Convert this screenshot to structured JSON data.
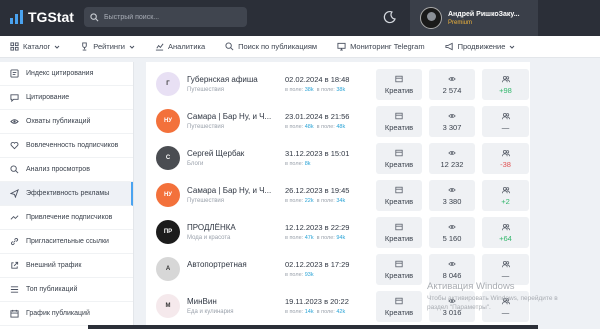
{
  "header": {
    "logo_text": "TGStat",
    "search_placeholder": "Быстрый поиск...",
    "user_name": "Андрей РишкоЗаку...",
    "user_plan": "Premium"
  },
  "nav": {
    "items": [
      {
        "label": "Каталог",
        "icon": "grid-icon",
        "dropdown": true
      },
      {
        "label": "Рейтинги",
        "icon": "trophy-icon",
        "dropdown": true
      },
      {
        "label": "Аналитика",
        "icon": "chart-icon",
        "dropdown": false
      },
      {
        "label": "Поиск по публикациям",
        "icon": "search-icon",
        "dropdown": false
      },
      {
        "label": "Мониторинг Telegram",
        "icon": "monitor-icon",
        "dropdown": false
      },
      {
        "label": "Продвижение",
        "icon": "megaphone-icon",
        "dropdown": true
      }
    ]
  },
  "sidebar": {
    "items": [
      {
        "label": "Индекс цитирования",
        "icon": "quote-icon"
      },
      {
        "label": "Цитирование",
        "icon": "comment-icon"
      },
      {
        "label": "Охваты публикаций",
        "icon": "eye-icon"
      },
      {
        "label": "Вовлеченность подписчиков",
        "icon": "heart-icon"
      },
      {
        "label": "Анализ просмотров",
        "icon": "magnifier-icon"
      },
      {
        "label": "Эффективность рекламы",
        "icon": "send-icon",
        "active": true
      },
      {
        "label": "Привлечение подписчиков",
        "icon": "trend-icon"
      },
      {
        "label": "Пригласительные ссылки",
        "icon": "link-icon"
      },
      {
        "label": "Внешний трафик",
        "icon": "external-icon"
      },
      {
        "label": "Топ публикаций",
        "icon": "list-icon"
      },
      {
        "label": "График публикаций",
        "icon": "calendar-icon"
      }
    ]
  },
  "table": {
    "creative_label": "Креатив",
    "rows": [
      {
        "name": "Губернская афиша",
        "category": "Путешествия",
        "date": "02.02.2024 в 18:48",
        "subs_prefix": "в поле:",
        "subs_a": "38k",
        "subs_mid": "в поле:",
        "subs_b": "38k",
        "views": "2 574",
        "growth": "+98",
        "growth_type": "pos",
        "avatar_color": "#e8e0f4",
        "avatar_text": "Г"
      },
      {
        "name": "Самара | Бар Ну, и Ч...",
        "category": "Путешествия",
        "date": "23.01.2024 в 21:56",
        "subs_prefix": "в поле:",
        "subs_a": "48k",
        "subs_mid": "в поле:",
        "subs_b": "48k",
        "views": "3 307",
        "growth": "—",
        "growth_type": "none",
        "avatar_color": "#f3713b",
        "avatar_text": "НУ"
      },
      {
        "name": "Сергей Щербак",
        "category": "Блоги",
        "date": "31.12.2023 в 15:01",
        "subs_prefix": "в поле:",
        "subs_a": "8k",
        "subs_mid": "",
        "subs_b": "",
        "views": "12 232",
        "growth": "-38",
        "growth_type": "neg",
        "avatar_color": "#4a4d52",
        "avatar_text": "С"
      },
      {
        "name": "Самара | Бар Ну, и Ч...",
        "category": "Путешествия",
        "date": "26.12.2023 в 19:45",
        "subs_prefix": "в поле:",
        "subs_a": "22k",
        "subs_mid": "в поле:",
        "subs_b": "34k",
        "views": "3 380",
        "growth": "+2",
        "growth_type": "pos",
        "avatar_color": "#f3713b",
        "avatar_text": "НУ"
      },
      {
        "name": "ПРОДЛЁНКА",
        "category": "Мода и красота",
        "date": "12.12.2023 в 22:29",
        "subs_prefix": "в поле:",
        "subs_a": "47k",
        "subs_mid": "в поле:",
        "subs_b": "94k",
        "views": "5 160",
        "growth": "+64",
        "growth_type": "pos",
        "avatar_color": "#1c1c1c",
        "avatar_text": "ПР"
      },
      {
        "name": "Автопортретная",
        "category": "",
        "date": "02.12.2023 в 17:29",
        "subs_prefix": "в поле:",
        "subs_a": "93k",
        "subs_mid": "",
        "subs_b": "",
        "views": "8 046",
        "growth": "—",
        "growth_type": "none",
        "avatar_color": "#d7d7d7",
        "avatar_text": "А"
      },
      {
        "name": "МинВин",
        "category": "Еда и кулинария",
        "date": "19.11.2023 в 20:22",
        "subs_prefix": "в поле:",
        "subs_a": "14k",
        "subs_mid": "в поле:",
        "subs_b": "42k",
        "views": "3 016",
        "growth": "—",
        "growth_type": "none",
        "avatar_color": "#f5e9ec",
        "avatar_text": "М"
      }
    ]
  },
  "watermark": {
    "title": "Активация Windows",
    "line1": "Чтобы активировать Windows, перейдите в",
    "line2": "раздел \"Параметры\"."
  },
  "colors": {
    "topbar": "#2b2f38",
    "accent": "#4aa3f0",
    "positive": "#33b76c",
    "negative": "#e05252",
    "premium": "#f0b43c"
  }
}
